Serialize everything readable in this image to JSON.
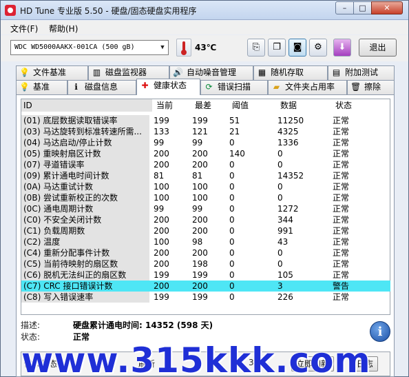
{
  "window": {
    "title": "HD Tune 专业版 5.50 - 硬盘/固态硬盘实用程序",
    "min": "–",
    "max": "□",
    "close": "✕"
  },
  "menu": {
    "file": "文件(F)",
    "help": "帮助(H)"
  },
  "toolbar": {
    "drive": "WDC WD5000AAKX-001CA (500 gB)",
    "temperature": "43℃",
    "exit_label": "退出",
    "icons": [
      "copy-text-icon",
      "copy-all-icon",
      "camera-icon",
      "options-icon",
      "download-icon"
    ]
  },
  "tabs": {
    "row1": [
      "文件基准",
      "磁盘监视器",
      "自动噪音管理",
      "随机存取",
      "附加测试"
    ],
    "row2": [
      "基准",
      "磁盘信息",
      "健康状态",
      "错误扫描",
      "文件夹占用率",
      "擦除"
    ],
    "active": "健康状态"
  },
  "table": {
    "headers": {
      "id": "ID",
      "current": "当前",
      "worst": "最差",
      "threshold": "阈值",
      "data": "数据",
      "status": "状态"
    },
    "rows": [
      {
        "id": "(01) 底层数据读取错误率",
        "current": "199",
        "worst": "199",
        "threshold": "51",
        "data": "11250",
        "status": "正常"
      },
      {
        "id": "(03) 马达旋转到标准转速所需...",
        "current": "133",
        "worst": "121",
        "threshold": "21",
        "data": "4325",
        "status": "正常"
      },
      {
        "id": "(04) 马达启动/停止计数",
        "current": "99",
        "worst": "99",
        "threshold": "0",
        "data": "1336",
        "status": "正常"
      },
      {
        "id": "(05) 重映射扇区计数",
        "current": "200",
        "worst": "200",
        "threshold": "140",
        "data": "0",
        "status": "正常"
      },
      {
        "id": "(07) 寻道错误率",
        "current": "200",
        "worst": "200",
        "threshold": "0",
        "data": "0",
        "status": "正常"
      },
      {
        "id": "(09) 累计通电时间计数",
        "current": "81",
        "worst": "81",
        "threshold": "0",
        "data": "14352",
        "status": "正常"
      },
      {
        "id": "(0A) 马达重试计数",
        "current": "100",
        "worst": "100",
        "threshold": "0",
        "data": "0",
        "status": "正常"
      },
      {
        "id": "(0B) 尝试重新校正的次数",
        "current": "100",
        "worst": "100",
        "threshold": "0",
        "data": "0",
        "status": "正常"
      },
      {
        "id": "(0C) 通电周期计数",
        "current": "99",
        "worst": "99",
        "threshold": "0",
        "data": "1272",
        "status": "正常"
      },
      {
        "id": "(C0) 不安全关闭计数",
        "current": "200",
        "worst": "200",
        "threshold": "0",
        "data": "344",
        "status": "正常"
      },
      {
        "id": "(C1) 负载周期数",
        "current": "200",
        "worst": "200",
        "threshold": "0",
        "data": "991",
        "status": "正常"
      },
      {
        "id": "(C2) 温度",
        "current": "100",
        "worst": "98",
        "threshold": "0",
        "data": "43",
        "status": "正常"
      },
      {
        "id": "(C4) 重新分配事件计数",
        "current": "200",
        "worst": "200",
        "threshold": "0",
        "data": "0",
        "status": "正常"
      },
      {
        "id": "(C5) 当前待映射的扇区数",
        "current": "200",
        "worst": "198",
        "threshold": "0",
        "data": "0",
        "status": "正常"
      },
      {
        "id": "(C6) 脱机无法纠正的扇区数",
        "current": "199",
        "worst": "199",
        "threshold": "0",
        "data": "105",
        "status": "正常"
      },
      {
        "id": "(C7) CRC 接口错误计数",
        "current": "200",
        "worst": "200",
        "threshold": "0",
        "data": "3",
        "status": "警告"
      },
      {
        "id": "(C8) 写入错误速率",
        "current": "199",
        "worst": "199",
        "threshold": "0",
        "data": "226",
        "status": "正常"
      }
    ],
    "warn_color": "#4ee6f5"
  },
  "details": {
    "desc_label": "描述:",
    "desc_value": "硬盘累计通电时间: 14352 (598 天)",
    "state_label": "状态:",
    "state_value": "正常"
  },
  "bottom": {
    "label1": "健康状态",
    "label2": "刷新",
    "button": "立即刷新",
    "time": "3:45",
    "log": "日志"
  },
  "watermark": "www.315kkk.com"
}
